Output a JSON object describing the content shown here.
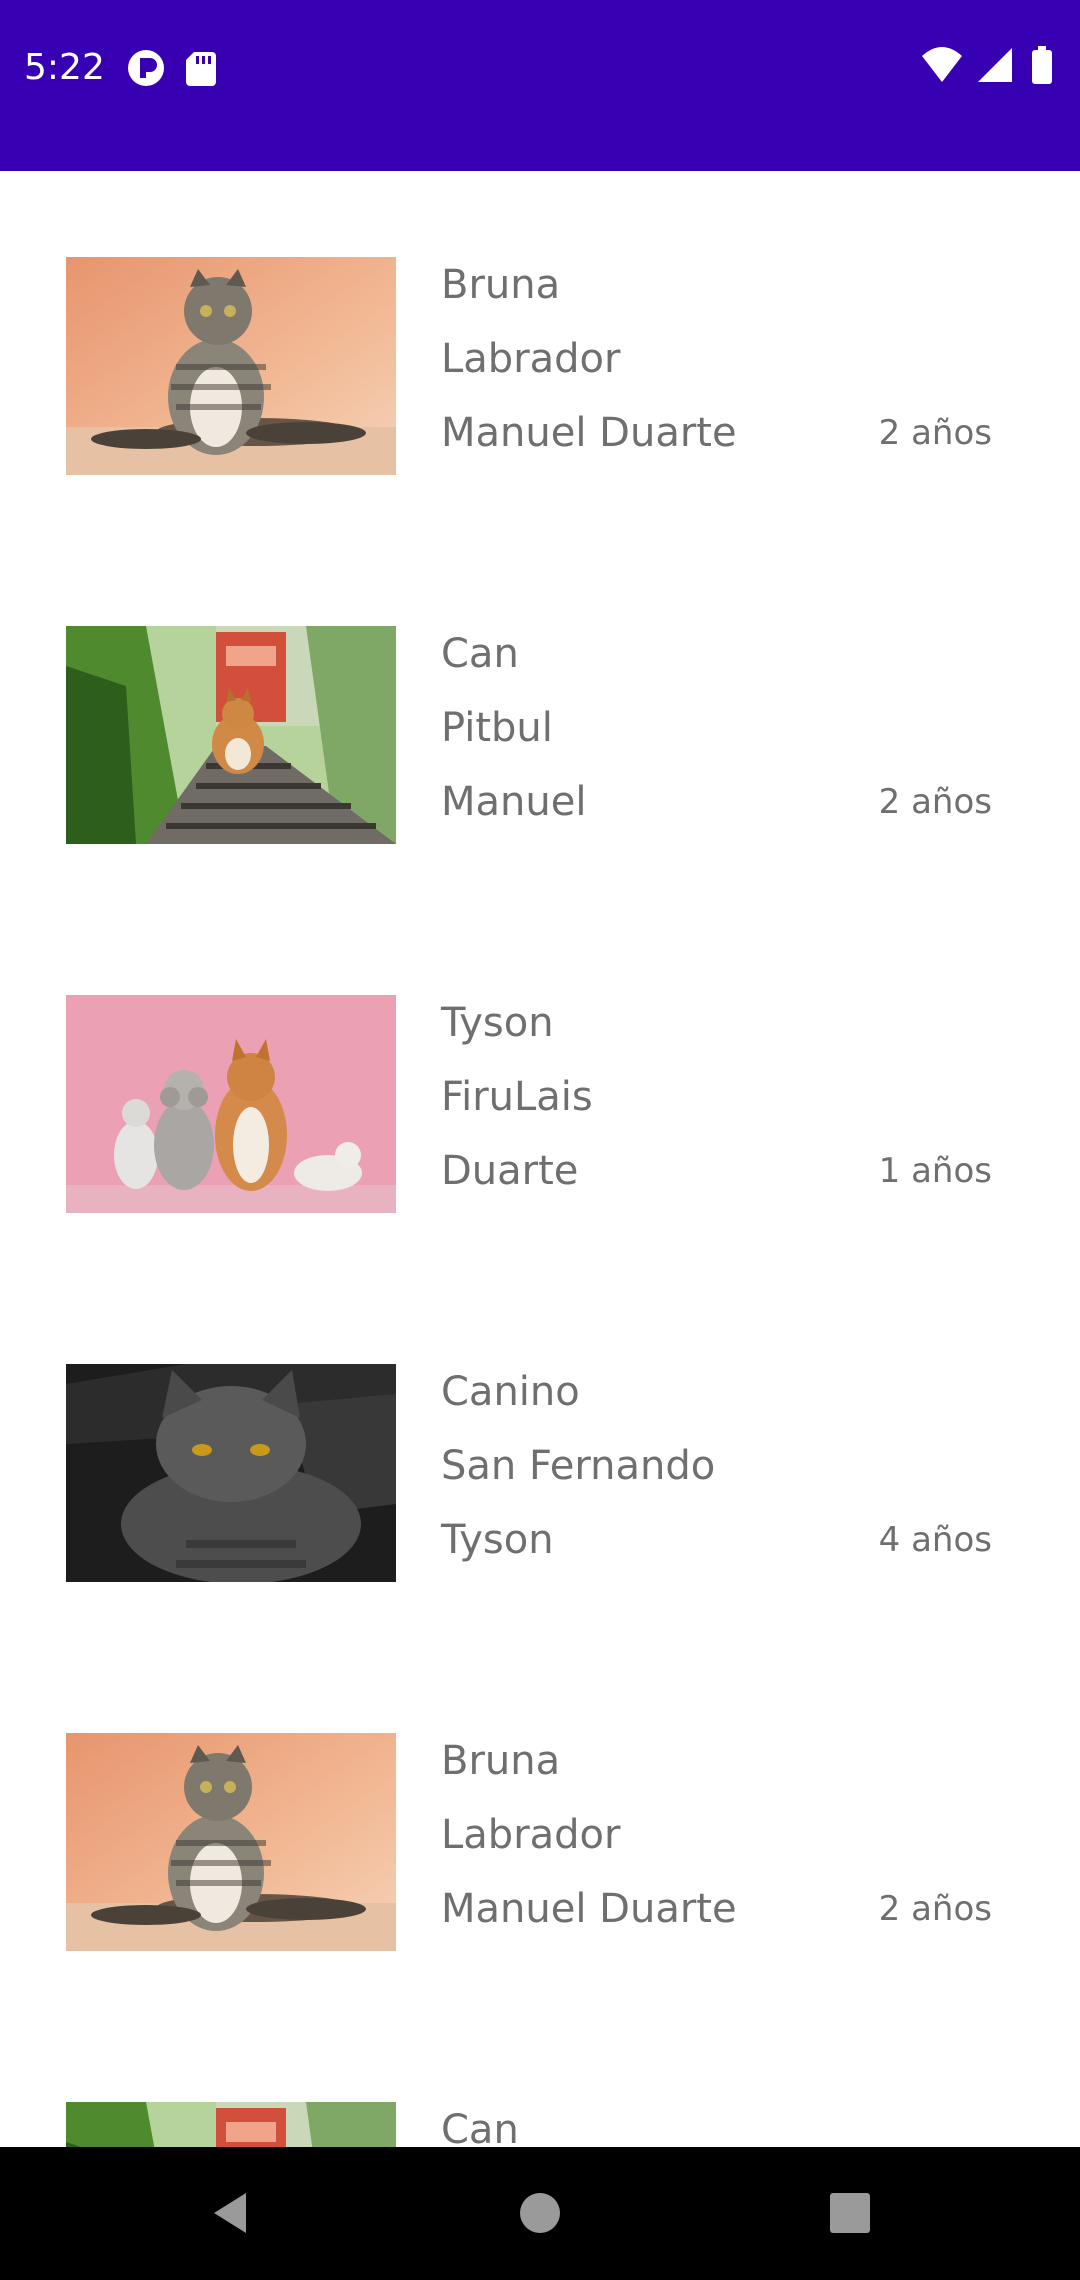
{
  "status_bar": {
    "time": "5:22",
    "left_icons": [
      "pocket-icon",
      "sd-card-icon"
    ],
    "right_icons": [
      "wifi-icon",
      "signal-icon",
      "battery-icon"
    ],
    "background_color": "#3700b3"
  },
  "pets": [
    {
      "name": "Bruna",
      "breed": "Labrador",
      "owner": "Manuel Duarte",
      "age": "2 años",
      "image": "tabby-cat-photo"
    },
    {
      "name": "Can",
      "breed": "Pitbul",
      "owner": "Manuel",
      "age": "2 años",
      "image": "corgi-on-tracks-photo"
    },
    {
      "name": "Tyson",
      "breed": "FiruLais",
      "owner": "Duarte",
      "age": "1 años",
      "image": "pets-pink-background-photo"
    },
    {
      "name": "Canino",
      "breed": "San Fernando",
      "owner": "Tyson",
      "age": "4 años",
      "image": "gray-cat-photo"
    },
    {
      "name": "Bruna",
      "breed": "Labrador",
      "owner": "Manuel Duarte",
      "age": "2 años",
      "image": "tabby-cat-photo"
    },
    {
      "name": "Can",
      "breed": "",
      "owner": "",
      "age": "",
      "image": "corgi-on-tracks-photo"
    }
  ],
  "navigation": {
    "buttons": [
      "back-icon",
      "home-icon",
      "recents-icon"
    ]
  }
}
